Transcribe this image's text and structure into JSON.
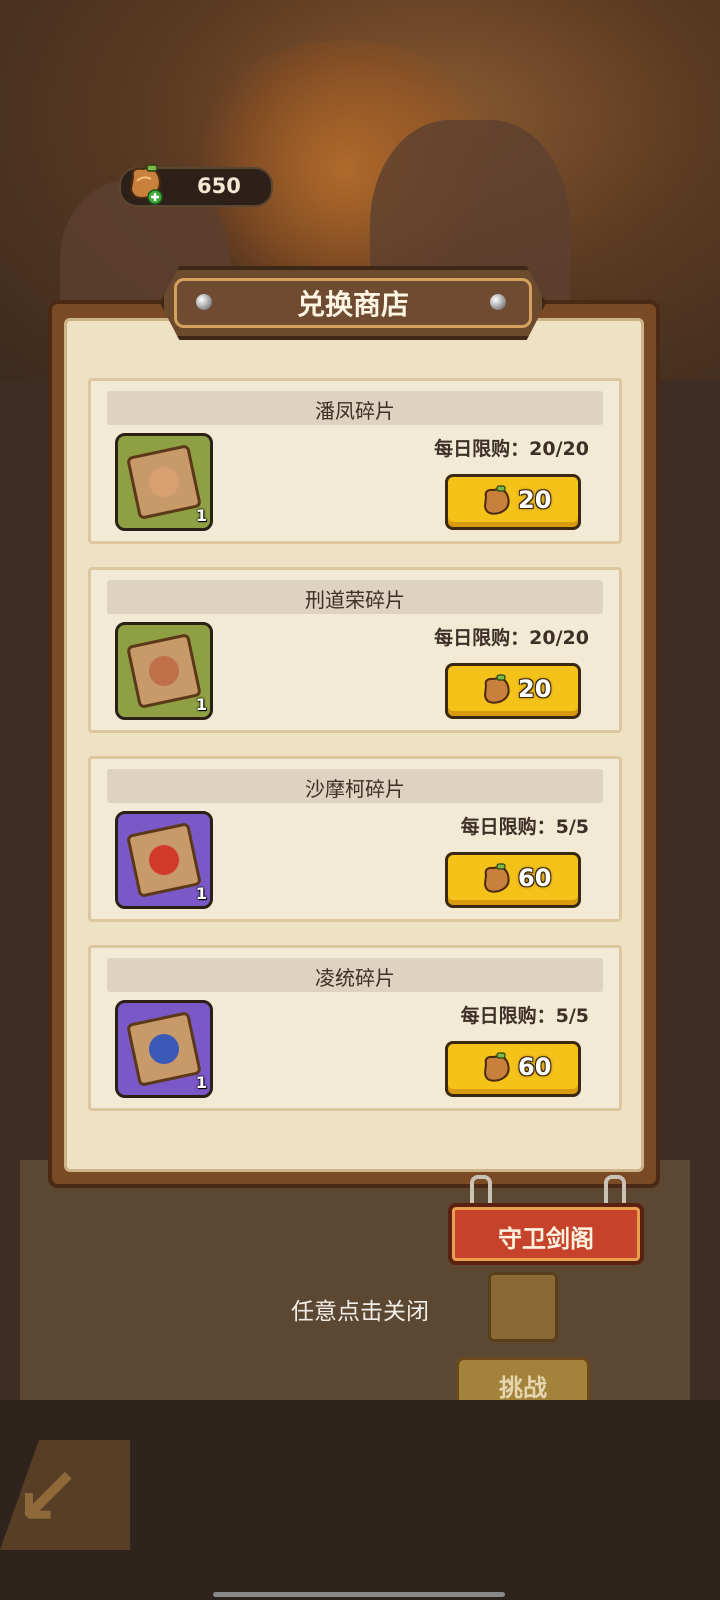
{
  "currency": {
    "icon": "meat-currency-icon",
    "value": "650"
  },
  "dialog": {
    "title": "兑换商店"
  },
  "items": [
    {
      "name": "潘凤碎片",
      "limit": "每日限购：20/20",
      "price": "20",
      "count": "1",
      "rarity_color": "#8ea043"
    },
    {
      "name": "刑道荣碎片",
      "limit": "每日限购：20/20",
      "price": "20",
      "count": "1",
      "rarity_color": "#8ea043"
    },
    {
      "name": "沙摩柯碎片",
      "limit": "每日限购：5/5",
      "price": "60",
      "count": "1",
      "rarity_color": "#7a58c8"
    },
    {
      "name": "凌统碎片",
      "limit": "每日限购：5/5",
      "price": "60",
      "count": "1",
      "rarity_color": "#7a58c8"
    }
  ],
  "sign": {
    "label": "守卫剑阁"
  },
  "close_hint": "任意点击关闭",
  "background": {
    "challenge_label": "挑战"
  }
}
